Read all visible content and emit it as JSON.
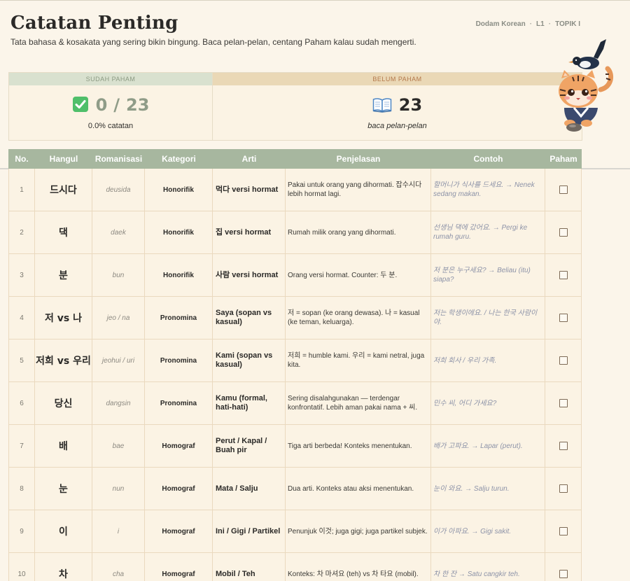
{
  "header": {
    "title": "Catatan Penting",
    "subtitle": "Tata bahasa & kosakata yang sering bikin bingung. Baca pelan-pelan, centang Paham kalau sudah mengerti.",
    "breadcrumb": [
      "Dodam Korean",
      "L1",
      "TOPIK I"
    ]
  },
  "stats": {
    "done": {
      "label": "SUDAH PAHAM",
      "count": "0",
      "total": "23",
      "percent_text": "0.0% catatan",
      "icon": "check-box-icon",
      "color": "#8f9c88"
    },
    "todo": {
      "label": "BELUM PAHAM",
      "count": "23",
      "note": "baca pelan-pelan",
      "icon": "open-book-icon"
    }
  },
  "table": {
    "columns": [
      "No.",
      "Hangul",
      "Romanisasi",
      "Kategori",
      "Arti",
      "Penjelasan",
      "Contoh",
      "Paham"
    ],
    "header_color": "#a7b79f",
    "rows": [
      {
        "no": "1",
        "hangul": "드시다",
        "rom": "deusida",
        "kategori": "Honorifik",
        "arti": "먹다 versi hormat",
        "penjelasan": "Pakai untuk orang yang dihormati. 잡수시다 lebih hormat lagi.",
        "contoh": "할머니가 식사를 드세요. → Nenek sedang makan."
      },
      {
        "no": "2",
        "hangul": "댁",
        "rom": "daek",
        "kategori": "Honorifik",
        "arti": "집 versi hormat",
        "penjelasan": "Rumah milik orang yang dihormati.",
        "contoh": "선생님 댁에 갔어요. → Pergi ke rumah guru."
      },
      {
        "no": "3",
        "hangul": "분",
        "rom": "bun",
        "kategori": "Honorifik",
        "arti": "사람 versi hormat",
        "penjelasan": "Orang versi hormat. Counter: 두 분.",
        "contoh": "저 분은 누구세요? → Beliau (itu) siapa?"
      },
      {
        "no": "4",
        "hangul": "저 vs 나",
        "rom": "jeo / na",
        "kategori": "Pronomina",
        "arti": "Saya (sopan vs kasual)",
        "penjelasan": "저 = sopan (ke orang dewasa). 나 = kasual (ke teman, keluarga).",
        "contoh": "저는 학생이에요. / 나는 한국 사람이야."
      },
      {
        "no": "5",
        "hangul": "저희 vs 우리",
        "rom": "jeohui / uri",
        "kategori": "Pronomina",
        "arti": "Kami (sopan vs kasual)",
        "penjelasan": "저희 = humble kami. 우리 = kami netral, juga kita.",
        "contoh": "저희 회사 / 우리 가족."
      },
      {
        "no": "6",
        "hangul": "당신",
        "rom": "dangsin",
        "kategori": "Pronomina",
        "arti": "Kamu (formal, hati-hati)",
        "penjelasan": "Sering disalahgunakan — terdengar konfrontatif. Lebih aman pakai nama + 씨.",
        "contoh": "민수 씨, 어디 가세요?"
      },
      {
        "no": "7",
        "hangul": "배",
        "rom": "bae",
        "kategori": "Homograf",
        "arti": "Perut / Kapal / Buah pir",
        "penjelasan": "Tiga arti berbeda! Konteks menentukan.",
        "contoh": "배가 고파요. → Lapar (perut)."
      },
      {
        "no": "8",
        "hangul": "눈",
        "rom": "nun",
        "kategori": "Homograf",
        "arti": "Mata / Salju",
        "penjelasan": "Dua arti. Konteks atau aksi menentukan.",
        "contoh": "눈이 와요. → Salju turun."
      },
      {
        "no": "9",
        "hangul": "이",
        "rom": "i",
        "kategori": "Homograf",
        "arti": "Ini / Gigi / Partikel",
        "penjelasan": "Penunjuk 이것; juga gigi; juga partikel subjek.",
        "contoh": "이가 아파요. → Gigi sakit."
      },
      {
        "no": "10",
        "hangul": "차",
        "rom": "cha",
        "kategori": "Homograf",
        "arti": "Mobil / Teh",
        "penjelasan": "Konteks: 차 마셔요 (teh) vs 차 타요 (mobil).",
        "contoh": "차 한 잔 → Satu cangkir teh."
      }
    ]
  },
  "mascot": {
    "icon": "tiger-magpie-mascot-icon"
  }
}
